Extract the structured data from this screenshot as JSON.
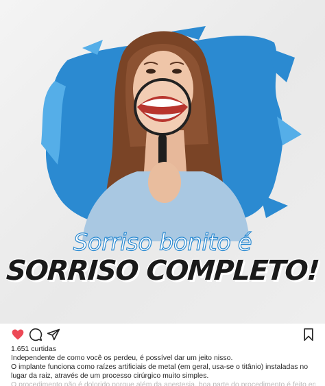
{
  "post": {
    "headline_line1": "Sorriso bonito é",
    "headline_line2": "SORRISO COMPLETO!",
    "colors": {
      "brush": "#2b8ad1",
      "brush_light": "#55aee8",
      "like": "#ed4956"
    }
  },
  "actions": {
    "like_icon": "heart-icon",
    "comment_icon": "comment-icon",
    "share_icon": "share-icon",
    "save_icon": "bookmark-icon"
  },
  "caption": {
    "likes": "1.651 curtidas",
    "line1": "Independente de como você os perdeu, é possível dar um jeito nisso.",
    "line2": "O implante funciona como raízes artificiais de metal (em geral, usa-se o titânio) instaladas no lugar da raiz, através de um processo cirúrgico muito simples.",
    "line3": "O procedimento não é dolorido porque além da anestesia, boa parte do procedimento é feito em tecidos ósseos, que"
  }
}
